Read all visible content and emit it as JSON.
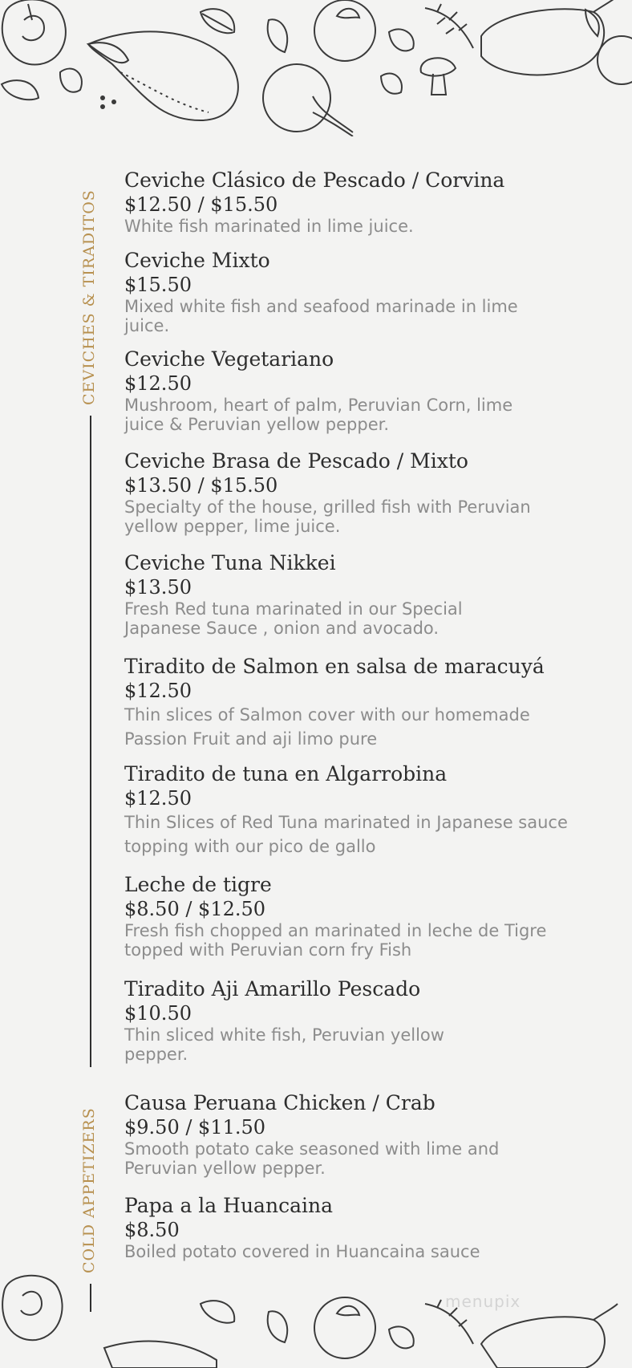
{
  "sections": [
    {
      "label": "CEVICHES & TIRADITOS",
      "items": [
        {
          "name": "Ceviche Clásico de Pescado / Corvina",
          "price": "$12.50 / $15.50",
          "desc": "White fish marinated in lime juice."
        },
        {
          "name": "Ceviche Mixto",
          "price": "$15.50",
          "desc": "Mixed white fish and seafood marinade in lime juice."
        },
        {
          "name": "Ceviche Vegetariano",
          "price": "$12.50",
          "desc": "Mushroom, heart of palm, Peruvian Corn, lime juice & Peruvian yellow pepper."
        },
        {
          "name": "Ceviche Brasa de Pescado / Mixto",
          "price": "$13.50 / $15.50",
          "desc": "Specialty of the house, grilled fish with Peruvian yellow pepper, lime juice."
        },
        {
          "name": "Ceviche Tuna Nikkei",
          "price": "$13.50",
          "desc": "Fresh Red tuna marinated in our Special Japanese Sauce , onion and avocado."
        },
        {
          "name": "Tiradito de Salmon en salsa de maracuyá",
          "price": "$12.50",
          "desc": "Thin slices of Salmon cover with our homemade Passion Fruit and aji limo pure"
        },
        {
          "name": "Tiradito de tuna en  Algarrobina",
          "price": "$12.50",
          "desc": "Thin Slices of Red Tuna marinated in Japanese sauce topping with our pico de gallo"
        },
        {
          "name": "Leche de tigre",
          "price": "$8.50 / $12.50",
          "desc": "Fresh fish chopped an marinated in leche de Tigre topped with Peruvian corn fry Fish"
        },
        {
          "name": "Tiradito Aji Amarillo Pescado",
          "price": "$10.50",
          "desc": "Thin sliced white fish, Peruvian yellow pepper."
        }
      ]
    },
    {
      "label": "COLD APPETIZERS",
      "items": [
        {
          "name": "Causa Peruana Chicken / Crab",
          "price": "$9.50 / $11.50",
          "desc": "Smooth potato cake seasoned with lime and Peruvian yellow pepper."
        },
        {
          "name": "Papa a la Huancaina",
          "price": "$8.50",
          "desc": "Boiled potato covered in Huancaina sauce"
        }
      ]
    }
  ],
  "watermark": "menupix",
  "colors": {
    "background": "#f3f3f2",
    "accent": "#b7904f",
    "text": "#2d2d2d",
    "muted": "#8c8c8c"
  }
}
